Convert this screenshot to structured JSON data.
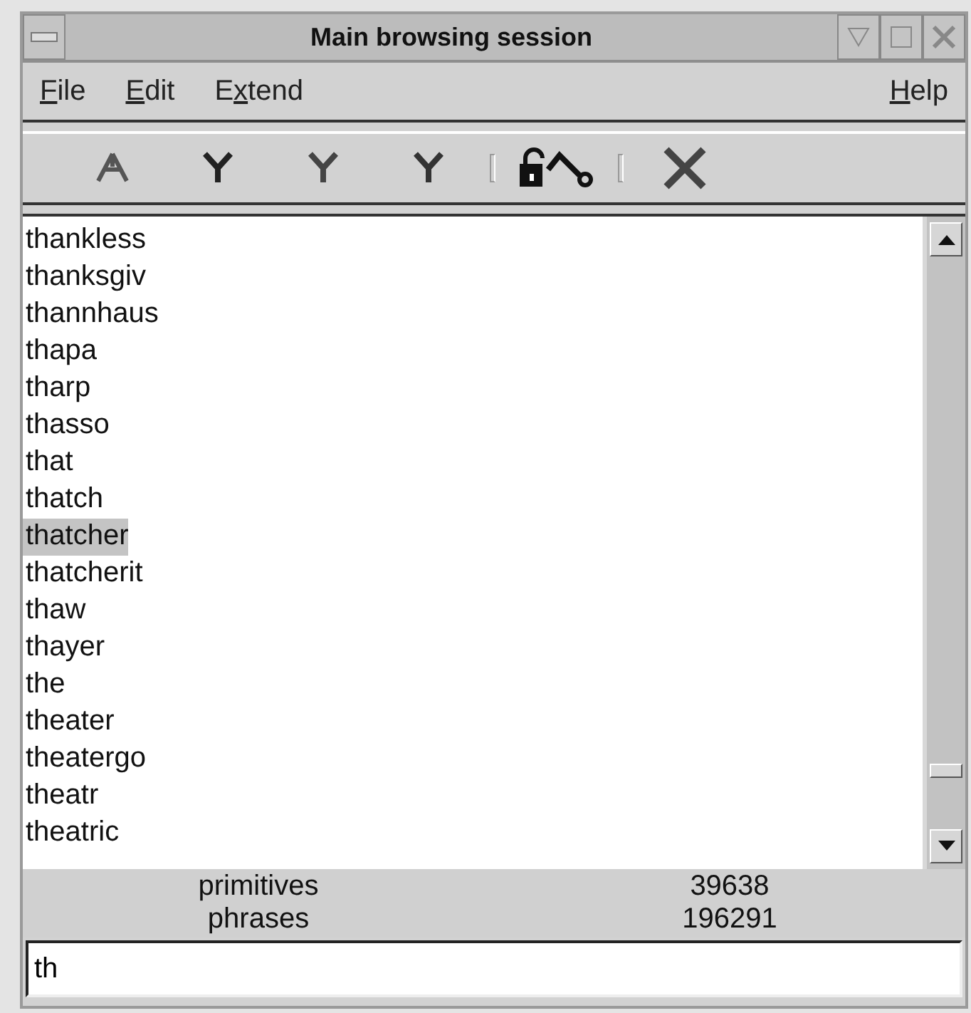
{
  "window": {
    "title": "Main browsing session"
  },
  "menu": {
    "left": [
      {
        "key": "F",
        "after": "ile"
      },
      {
        "key": "E",
        "after": "dit"
      },
      {
        "before": "E",
        "key": "x",
        "after": "tend"
      }
    ],
    "right": [
      {
        "key": "H",
        "after": "elp"
      }
    ]
  },
  "list": [
    {
      "text": "thankless",
      "selected": false
    },
    {
      "text": "thanksgiv",
      "selected": false
    },
    {
      "text": "thannhaus",
      "selected": false
    },
    {
      "text": "thapa",
      "selected": false
    },
    {
      "text": "tharp",
      "selected": false
    },
    {
      "text": "thasso",
      "selected": false
    },
    {
      "text": "that",
      "selected": false
    },
    {
      "text": "thatch",
      "selected": false
    },
    {
      "text": "thatcher",
      "selected": true
    },
    {
      "text": "thatcherit",
      "selected": false
    },
    {
      "text": "thaw",
      "selected": false
    },
    {
      "text": "thayer",
      "selected": false
    },
    {
      "text": "the",
      "selected": false
    },
    {
      "text": "theater",
      "selected": false
    },
    {
      "text": "theatergo",
      "selected": false
    },
    {
      "text": "theatr",
      "selected": false
    },
    {
      "text": "theatric",
      "selected": false
    }
  ],
  "stats": [
    {
      "label": "primitives",
      "value": "39638"
    },
    {
      "label": "phrases",
      "value": "196291"
    }
  ],
  "input": {
    "value": "th"
  }
}
